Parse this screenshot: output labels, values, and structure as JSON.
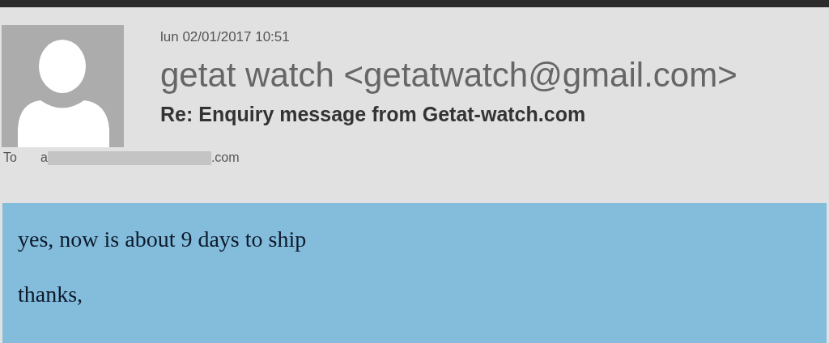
{
  "message": {
    "date": "lun 02/01/2017 10:51",
    "sender": "getat watch <getatwatch@gmail.com>",
    "subject": "Re: Enquiry message from Getat-watch.com",
    "to": {
      "label": "To",
      "address_start": "a",
      "address_end": ".com"
    }
  },
  "body": [
    "yes, now is about 9 days to ship",
    "thanks,"
  ]
}
